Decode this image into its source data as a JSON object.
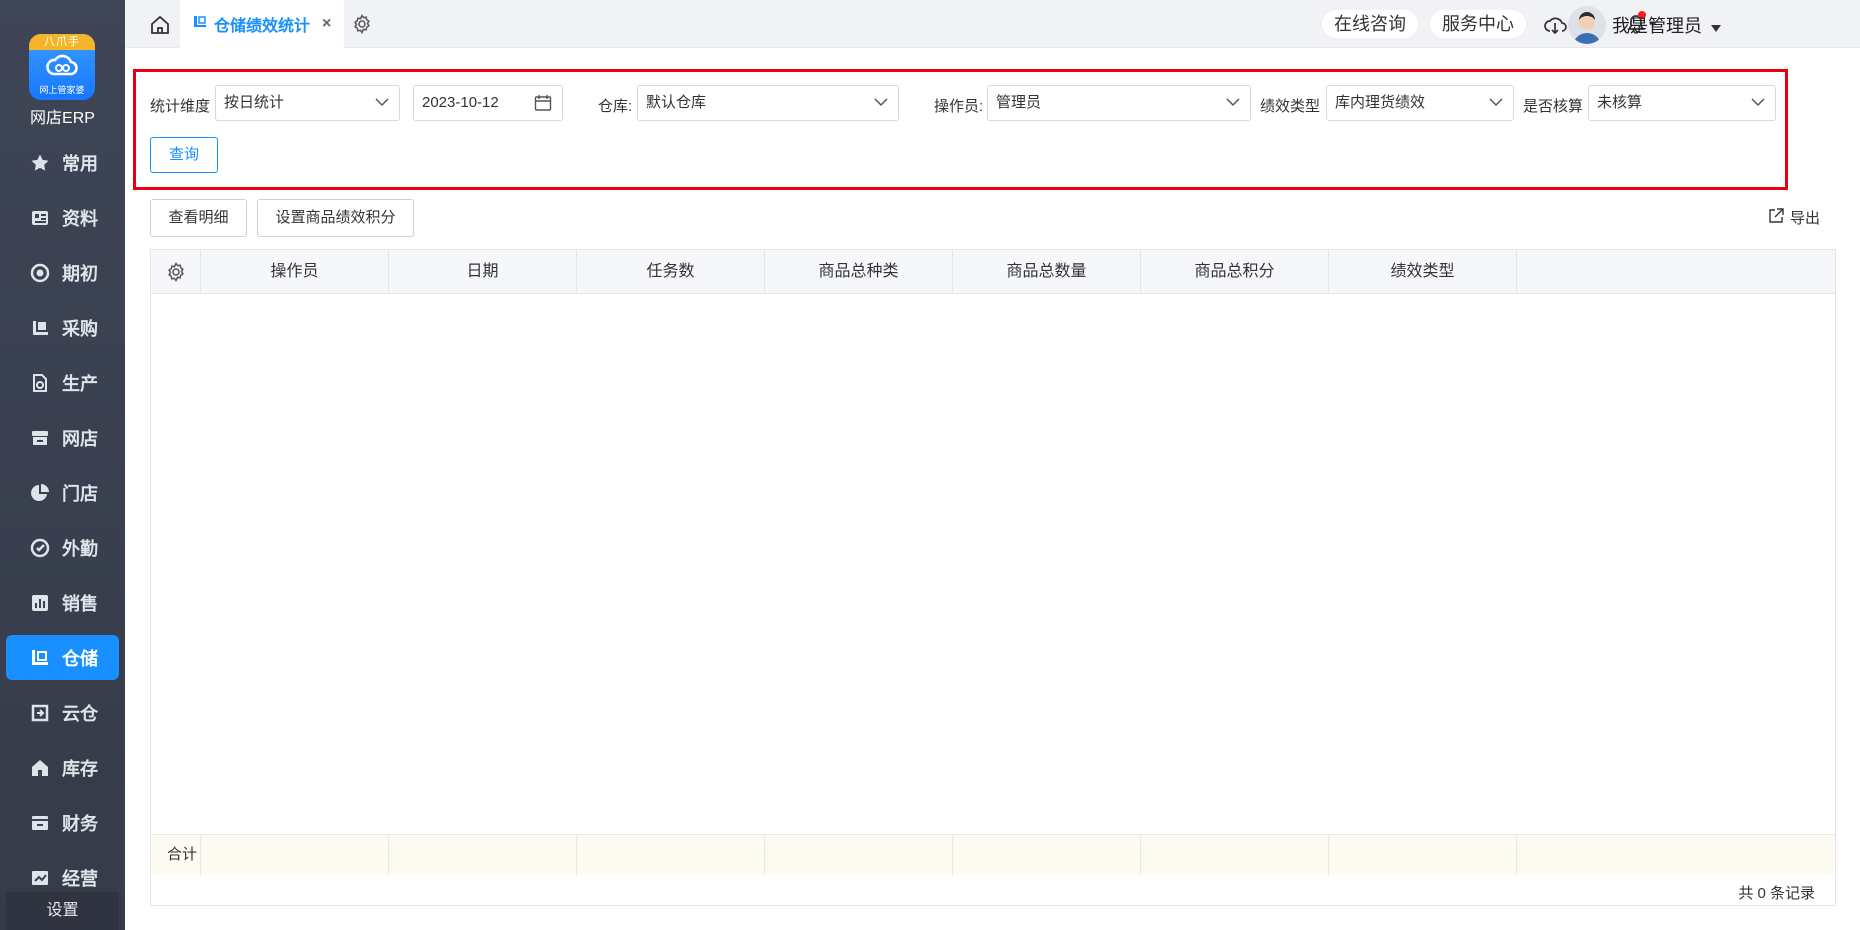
{
  "app": {
    "brand": "网店ERP",
    "logo_badge": "八爪手",
    "logo_caption": "网上管家婆",
    "settings_label": "设置"
  },
  "sidebar": {
    "items": [
      {
        "label": "常用",
        "icon": "star-icon"
      },
      {
        "label": "资料",
        "icon": "id-card-icon"
      },
      {
        "label": "期初",
        "icon": "target-icon"
      },
      {
        "label": "采购",
        "icon": "purchase-icon"
      },
      {
        "label": "生产",
        "icon": "production-icon"
      },
      {
        "label": "网店",
        "icon": "store-icon"
      },
      {
        "label": "门店",
        "icon": "pie-icon"
      },
      {
        "label": "外勤",
        "icon": "field-icon"
      },
      {
        "label": "销售",
        "icon": "bar-chart-icon"
      },
      {
        "label": "仓储",
        "icon": "warehouse-icon",
        "active": true
      },
      {
        "label": "云仓",
        "icon": "cloud-warehouse-icon"
      },
      {
        "label": "库存",
        "icon": "home-stock-icon"
      },
      {
        "label": "财务",
        "icon": "finance-icon"
      },
      {
        "label": "经营",
        "icon": "business-icon"
      }
    ]
  },
  "topbar": {
    "tab_label": "仓储绩效统计",
    "tab_close": "×",
    "consult": "在线咨询",
    "service": "服务中心",
    "username": "我是管理员"
  },
  "filters": {
    "dimension_label": "统计维度",
    "dimension_value": "按日统计",
    "date_value": "2023-10-12",
    "warehouse_label": "仓库:",
    "warehouse_value": "默认仓库",
    "operator_label": "操作员:",
    "operator_value": "管理员",
    "perf_type_label": "绩效类型",
    "perf_type_value": "库内理货绩效",
    "accounted_label": "是否核算",
    "accounted_value": "未核算",
    "query_button": "查询"
  },
  "actions": {
    "view_detail": "查看明细",
    "set_points": "设置商品绩效积分",
    "export": "导出"
  },
  "table": {
    "columns": [
      "操作员",
      "日期",
      "任务数",
      "商品总种类",
      "商品总数量",
      "商品总积分",
      "绩效类型"
    ],
    "total_label": "合计",
    "record_count": "共 0 条记录"
  },
  "colors": {
    "accent": "#1890ff",
    "highlight_border": "#e60012",
    "sidebar_bg": "#3a4150"
  }
}
